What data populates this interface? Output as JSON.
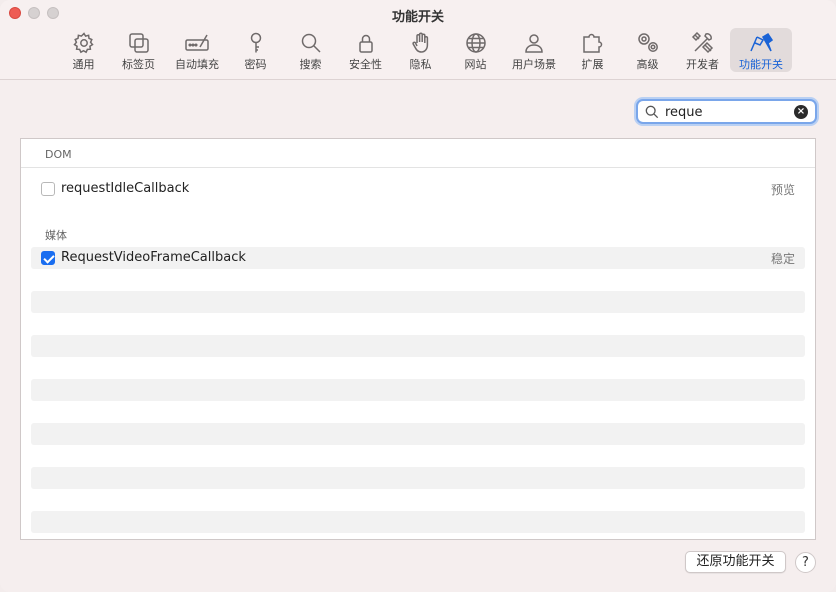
{
  "window": {
    "title": "功能开关"
  },
  "toolbar": {
    "items": [
      {
        "label": "通用",
        "icon": "gear-icon"
      },
      {
        "label": "标签页",
        "icon": "tabs-icon"
      },
      {
        "label": "自动填充",
        "icon": "autofill-icon"
      },
      {
        "label": "密码",
        "icon": "key-icon"
      },
      {
        "label": "搜索",
        "icon": "search-icon"
      },
      {
        "label": "安全性",
        "icon": "lock-icon"
      },
      {
        "label": "隐私",
        "icon": "hand-icon"
      },
      {
        "label": "网站",
        "icon": "globe-icon"
      },
      {
        "label": "用户场景",
        "icon": "person-icon"
      },
      {
        "label": "扩展",
        "icon": "puzzle-icon"
      },
      {
        "label": "高级",
        "icon": "gears-icon"
      },
      {
        "label": "开发者",
        "icon": "tools-icon"
      },
      {
        "label": "功能开关",
        "icon": "flags-icon"
      }
    ],
    "active_index": 12
  },
  "search": {
    "value": "reque"
  },
  "sections": {
    "dom": {
      "header": "DOM",
      "items": [
        {
          "name": "requestIdleCallback",
          "status": "预览",
          "checked": false
        }
      ]
    },
    "media": {
      "header": "媒体",
      "items": [
        {
          "name": "RequestVideoFrameCallback",
          "status": "稳定",
          "checked": true
        }
      ]
    }
  },
  "footer": {
    "restore_label": "还原功能开关",
    "help_label": "?"
  },
  "colors": {
    "accent": "#1a63d6",
    "checkbox": "#1a6ef0",
    "close": "#ee5c54"
  }
}
